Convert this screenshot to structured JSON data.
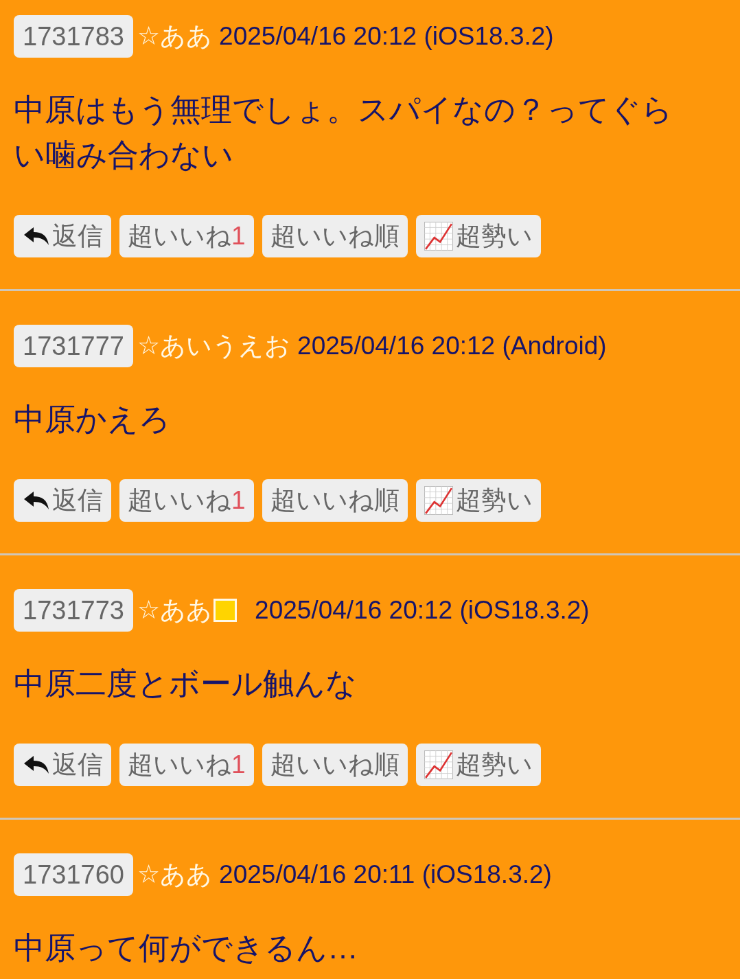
{
  "posts": [
    {
      "number": "1731783",
      "name": "☆ああ",
      "square_badge": false,
      "meta": "2025/04/16 20:12 (iOS18.3.2)",
      "body": "中原はもう無理でしょ。スパイなの？ってぐらい噛み合わない",
      "actions": {
        "reply": "返信",
        "like": "超いいね",
        "like_count": "1",
        "like_order": "超いいね順",
        "trend": "超勢い"
      }
    },
    {
      "number": "1731777",
      "name": "☆あいうえお",
      "square_badge": false,
      "meta": "2025/04/16 20:12 (Android)",
      "body": "中原かえろ",
      "actions": {
        "reply": "返信",
        "like": "超いいね",
        "like_count": "1",
        "like_order": "超いいね順",
        "trend": "超勢い"
      }
    },
    {
      "number": "1731773",
      "name": "☆ああ",
      "square_badge": true,
      "meta": "2025/04/16 20:12 (iOS18.3.2)",
      "body": "中原二度とボール触んな",
      "actions": {
        "reply": "返信",
        "like": "超いいね",
        "like_count": "1",
        "like_order": "超いいね順",
        "trend": "超勢い"
      }
    },
    {
      "number": "1731760",
      "name": "☆ああ",
      "square_badge": false,
      "meta": "2025/04/16 20:11 (iOS18.3.2)",
      "body": "中原って何ができるん…"
    }
  ]
}
